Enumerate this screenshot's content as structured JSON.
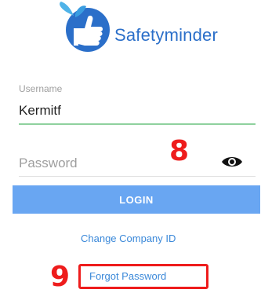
{
  "brand": {
    "name": "Safetyminder",
    "logo_icon": "thumbs-up-leaf-icon",
    "color": "#2b6fc9"
  },
  "form": {
    "username_label": "Username",
    "username_value": "Kermitf",
    "password_placeholder": "Password",
    "login_label": "LOGIN",
    "change_company_label": "Change Company ID",
    "forgot_password_label": "Forgot Password"
  },
  "annotations": {
    "marker_8": "8",
    "marker_9": "9",
    "color": "#ee1c1c"
  },
  "icons": {
    "password_toggle": "eye-icon"
  },
  "colors": {
    "accent": "#69a6f2",
    "link": "#3a88d9",
    "focus_underline": "#8fd19e"
  }
}
